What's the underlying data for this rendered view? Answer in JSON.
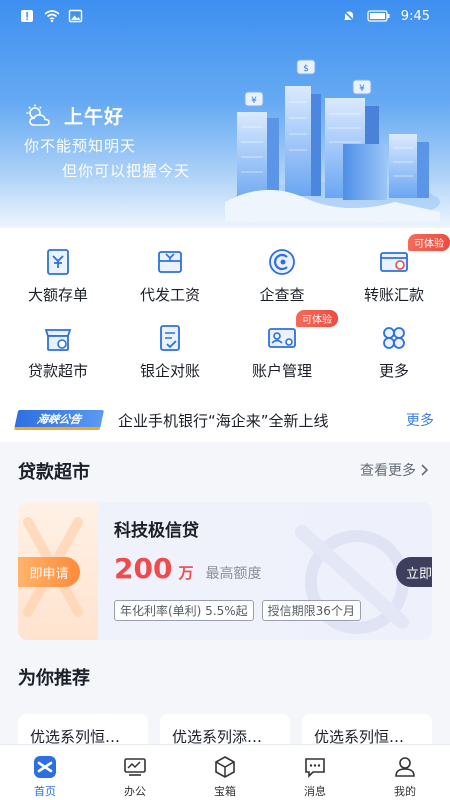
{
  "status_bar": {
    "time": "9:45"
  },
  "header": {
    "greeting": "上午好",
    "slogan_line1": "你不能预知明天",
    "slogan_line2": "但你可以把握今天"
  },
  "services": [
    {
      "label": "大额存单",
      "icon": "deposit-certificate-icon",
      "badge": ""
    },
    {
      "label": "代发工资",
      "icon": "payroll-icon",
      "badge": ""
    },
    {
      "label": "企查查",
      "icon": "company-search-icon",
      "badge": ""
    },
    {
      "label": "转账汇款",
      "icon": "transfer-card-icon",
      "badge": "可体验"
    },
    {
      "label": "贷款超市",
      "icon": "loan-market-icon",
      "badge": ""
    },
    {
      "label": "银企对账",
      "icon": "reconciliation-icon",
      "badge": ""
    },
    {
      "label": "账户管理",
      "icon": "account-card-icon",
      "badge": "可体验"
    },
    {
      "label": "更多",
      "icon": "more-grid-icon",
      "badge": ""
    }
  ],
  "notice": {
    "tag": "海峡公告",
    "text": "企业手机银行“海企来”全新上线",
    "more": "更多"
  },
  "loan_section": {
    "title": "贷款超市",
    "see_more": "查看更多",
    "apply_left": "即申请",
    "apply_right": "立即申请",
    "product_name": "科技极信贷",
    "amount": "200",
    "amount_unit": "万",
    "amount_label": "最高额度",
    "tags": [
      "年化利率(单利) 5.5%起",
      "授信期限36个月"
    ]
  },
  "recommend_section": {
    "title": "为你推荐",
    "cards": [
      "优选系列恒…",
      "优选系列添…",
      "优选系列恒…"
    ]
  },
  "tabbar": {
    "active": 0,
    "tabs": [
      {
        "label": "首页",
        "icon": "home-icon"
      },
      {
        "label": "办公",
        "icon": "office-icon"
      },
      {
        "label": "宝箱",
        "icon": "treasure-box-icon"
      },
      {
        "label": "消息",
        "icon": "message-icon"
      },
      {
        "label": "我的",
        "icon": "profile-icon"
      }
    ]
  },
  "colors": {
    "primary": "#2d6fe3",
    "header_blue": "#3d8ff0",
    "badge_red": "#ef4b3f",
    "amount_red": "#ef4b4b",
    "apply_orange": "#ff8a3a"
  }
}
